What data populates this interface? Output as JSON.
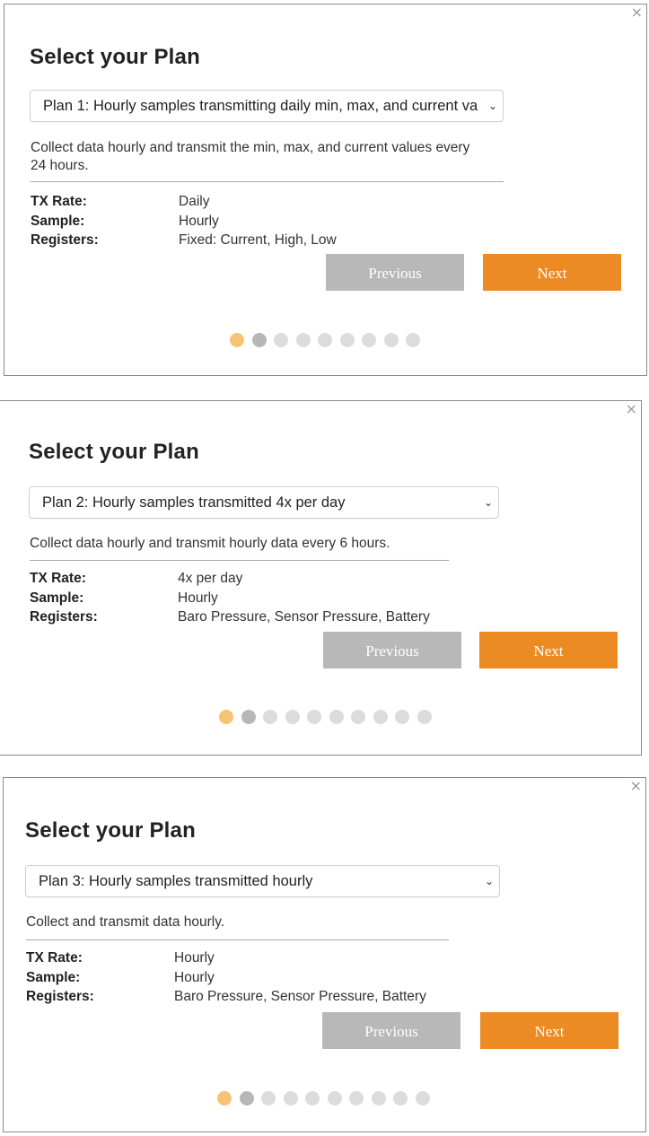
{
  "panels": [
    {
      "close_icon": "×",
      "title": "Select your Plan",
      "plan_select": {
        "selected": "Plan 1: Hourly samples transmitting daily min, max, and current va",
        "chevron": "⌄"
      },
      "description": "Collect data hourly and transmit the min, max, and current values every 24 hours.",
      "specs": [
        {
          "label": "TX Rate:",
          "value": "Daily"
        },
        {
          "label": "Sample:",
          "value": "Hourly"
        },
        {
          "label": "Registers:",
          "value": "Fixed: Current, High, Low"
        }
      ],
      "previous_label": "Previous",
      "next_label": "Next",
      "dots_total": 9,
      "dots_active_index": 0
    },
    {
      "close_icon": "×",
      "title": "Select your Plan",
      "plan_select": {
        "selected": "Plan 2: Hourly samples transmitted 4x per day",
        "chevron": "⌄"
      },
      "description": "Collect data hourly and transmit hourly data every 6 hours.",
      "specs": [
        {
          "label": "TX Rate:",
          "value": "4x per day"
        },
        {
          "label": "Sample:",
          "value": "Hourly"
        },
        {
          "label": "Registers:",
          "value": "Baro Pressure, Sensor Pressure, Battery"
        }
      ],
      "previous_label": "Previous",
      "next_label": "Next",
      "dots_total": 10,
      "dots_active_index": 0
    },
    {
      "close_icon": "×",
      "title": "Select your Plan",
      "plan_select": {
        "selected": "Plan 3: Hourly samples transmitted hourly",
        "chevron": "⌄"
      },
      "description": "Collect and transmit data hourly.",
      "specs": [
        {
          "label": "TX Rate:",
          "value": "Hourly"
        },
        {
          "label": "Sample:",
          "value": "Hourly"
        },
        {
          "label": "Registers:",
          "value": "Baro Pressure, Sensor Pressure, Battery"
        }
      ],
      "previous_label": "Previous",
      "next_label": "Next",
      "dots_total": 10,
      "dots_active_index": 0
    }
  ],
  "colors": {
    "next_button": "#ec8b23",
    "previous_button": "#b8b8b8",
    "dot_active": "#f6c374",
    "dot_second": "#b7b7b7",
    "dot_inactive": "#dcdcdc"
  }
}
